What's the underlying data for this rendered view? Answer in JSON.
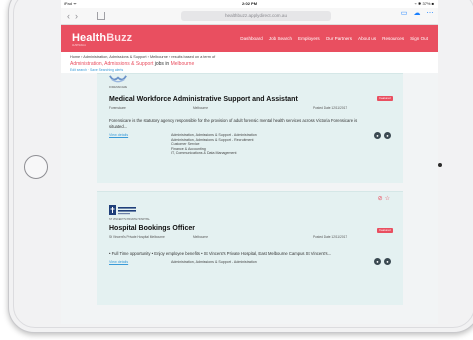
{
  "status_bar": {
    "left": "iPad ᯤ",
    "time": "2:02 PM",
    "battery": "⌁ ✱ 37% ■"
  },
  "browser": {
    "url": "healthbuzz.applydirect.com.au",
    "back": "‹",
    "forward": "›"
  },
  "site": {
    "logo_main": "Health",
    "logo_accent": "Buzz",
    "logo_tag": "AUSTRALIA",
    "nav": [
      "Dashboard",
      "Job Search",
      "Employers",
      "Our Partners",
      "About us",
      "Resources",
      "Sign Out"
    ]
  },
  "breadcrumb": {
    "path": "Home › Administration, Admissions & Support › Melbourne › results based on a term of",
    "title_prefix": "",
    "title_highlight": "Administration, Admissions & Support",
    "title_mid": " jobs in ",
    "title_location": "Melbourne",
    "links": "Edit search · Save Searching alerts"
  },
  "jobs": [
    {
      "logo_caption": "FORENSICARE",
      "title": "Medical Workforce Administrative Support and Assistant",
      "employer": "Forensicare",
      "location": "Melbourne",
      "posted": "Posted Date 12/11/2017",
      "badge": "Featured",
      "description": "Forensicare is the statutory agency responsible for the provision of adult forensic mental health services across Victoria Forensicare is situated...",
      "view_link": "View details",
      "categories": [
        "Administration, Admissions & Support - Administration",
        "Administration, Admissions & Support - Recruitment",
        "Customer Service",
        "Finance & Accounting",
        "IT, Communications & Data Management"
      ]
    },
    {
      "logo_caption": "ST VINCENT'S PRIVATE HOSPITAL",
      "title": "Hospital Bookings Officer",
      "employer": "St Vincent's Private Hospital Melbourne",
      "location": "Melbourne",
      "posted": "Posted Date 12/11/2017",
      "badge": "Featured",
      "description": "• Full Time opportunity • Enjoy employee benefits • St Vincent's Private Hospital, East Melbourne Campus St Vincent's...",
      "view_link": "View details",
      "categories": [
        "Administration, Admissions & Support - Administration"
      ]
    }
  ],
  "colors": {
    "brand": "#e94f60",
    "card_bg": "#e4f1f1",
    "link": "#3a9bd8"
  }
}
